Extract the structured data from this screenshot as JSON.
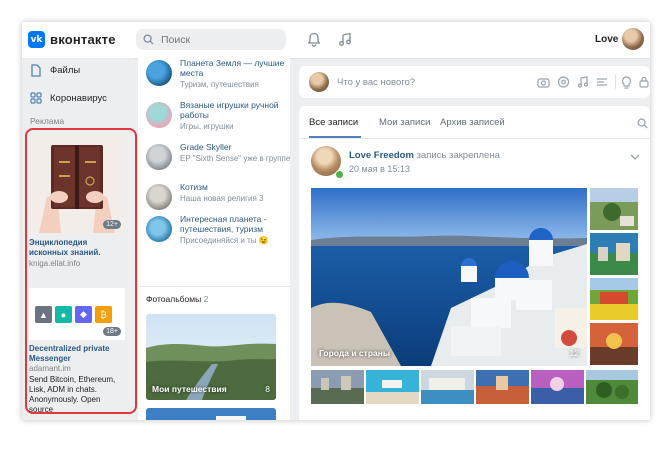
{
  "header": {
    "logo_text": "вконтакте",
    "logo_mark": "vk",
    "search_placeholder": "Поиск",
    "user_name": "Love"
  },
  "left_nav": {
    "items": [
      {
        "label": "Файлы",
        "icon": "file-icon"
      },
      {
        "label": "Коронавирус",
        "icon": "apps-icon"
      }
    ],
    "ads_label": "Реклама",
    "ads": [
      {
        "title": "Энциклопедия исконных знаний.",
        "domain": "kniga.ellat.info",
        "age": "12+"
      },
      {
        "title": "Decentralized private Messenger",
        "domain": "adamant.im",
        "description": "Send Bitcoin, Ethereum, Lisk, ADM in chats. Anonymously. Open source",
        "age": "18+"
      }
    ]
  },
  "groups": [
    {
      "title": "Планета Земля — лучшие места",
      "subtitle": "Туризм, путешествия"
    },
    {
      "title": "Вязаные игрушки ручной работы",
      "subtitle": "Игры, игрушки"
    },
    {
      "title": "Grade Skyller",
      "subtitle": "EP \"Sixth Sense\" уже в группе"
    },
    {
      "title": "Котизм",
      "subtitle": "Наша новая религия 3"
    },
    {
      "title": "Интересная планета - путешествия, туризм",
      "subtitle": "Присоединяйся и ты 😉"
    }
  ],
  "albums": {
    "heading": "Фотоальбомы",
    "count": "2",
    "items": [
      {
        "name": "Мои путешествия",
        "count": "8"
      }
    ]
  },
  "composer": {
    "placeholder": "Что у вас нового?"
  },
  "feed": {
    "tabs": [
      {
        "label": "Все записи",
        "active": true
      },
      {
        "label": "Мои записи",
        "active": false
      },
      {
        "label": "Архив записей",
        "active": false
      }
    ],
    "post": {
      "author": "Love Freedom",
      "pinned_text": "запись закреплена",
      "date": "20 мая в 15:13",
      "photo_label": "Города и страны",
      "photo_count": "12"
    }
  },
  "colors": {
    "accent": "#5181b8",
    "link": "#2a5885",
    "vk_blue": "#0077ff",
    "highlight": "#e0383b"
  }
}
